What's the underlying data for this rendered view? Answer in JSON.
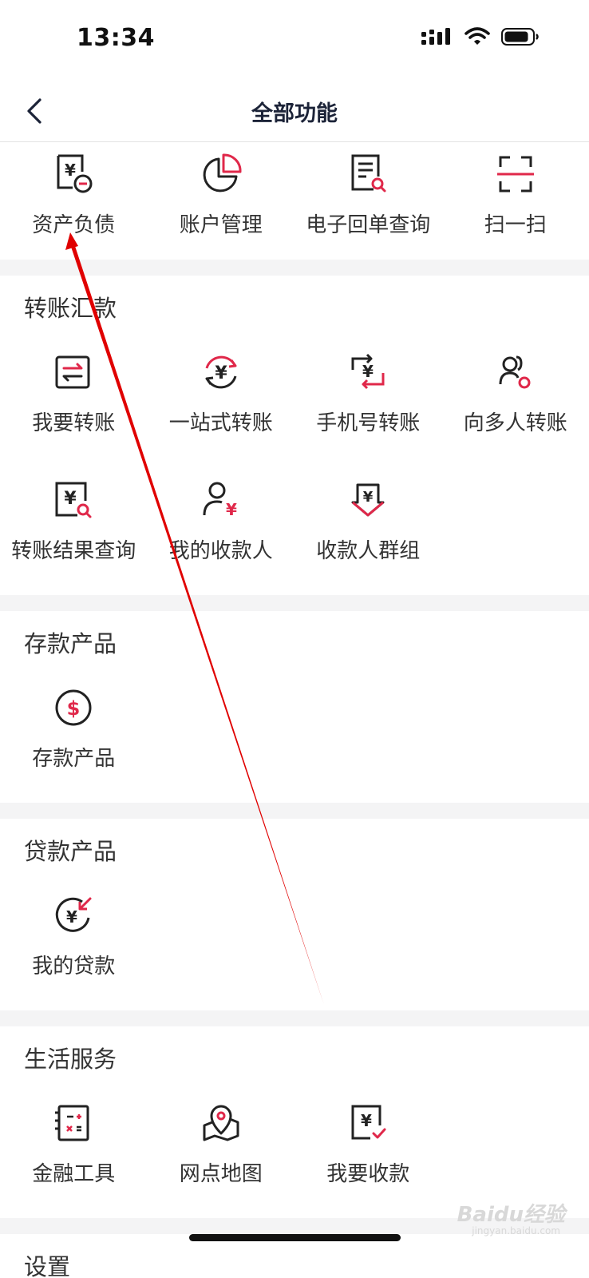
{
  "status_bar": {
    "time": "13:34"
  },
  "nav": {
    "title": "全部功能"
  },
  "top_items": [
    {
      "label": "资产负债",
      "icon": "asset-liability-icon"
    },
    {
      "label": "账户管理",
      "icon": "pie-chart-icon"
    },
    {
      "label": "电子回单查询",
      "icon": "receipt-search-icon"
    },
    {
      "label": "扫一扫",
      "icon": "scan-icon"
    }
  ],
  "sections": [
    {
      "title": "转账汇款",
      "items": [
        {
          "label": "我要转账",
          "icon": "transfer-icon"
        },
        {
          "label": "一站式转账",
          "icon": "one-stop-transfer-icon"
        },
        {
          "label": "手机号转账",
          "icon": "phone-transfer-icon"
        },
        {
          "label": "向多人转账",
          "icon": "multi-transfer-icon"
        },
        {
          "label": "转账结果查询",
          "icon": "transfer-result-search-icon"
        },
        {
          "label": "我的收款人",
          "icon": "payee-icon"
        },
        {
          "label": "收款人群组",
          "icon": "payee-group-icon"
        }
      ]
    },
    {
      "title": "存款产品",
      "items": [
        {
          "label": "存款产品",
          "icon": "dollar-circle-icon"
        }
      ]
    },
    {
      "title": "贷款产品",
      "items": [
        {
          "label": "我的贷款",
          "icon": "loan-icon"
        }
      ]
    },
    {
      "title": "生活服务",
      "items": [
        {
          "label": "金融工具",
          "icon": "calculator-icon"
        },
        {
          "label": "网点地图",
          "icon": "map-pin-icon"
        },
        {
          "label": "我要收款",
          "icon": "receive-money-icon"
        }
      ]
    },
    {
      "title": "设置",
      "items": []
    }
  ],
  "watermark": {
    "text": "Baidu经验",
    "url": "jingyan.baidu.com"
  },
  "colors": {
    "accent": "#e0284a",
    "icon": "#222222",
    "nav_title": "#1c2338",
    "separator": "#f4f4f5",
    "annotation": "#e00000"
  }
}
